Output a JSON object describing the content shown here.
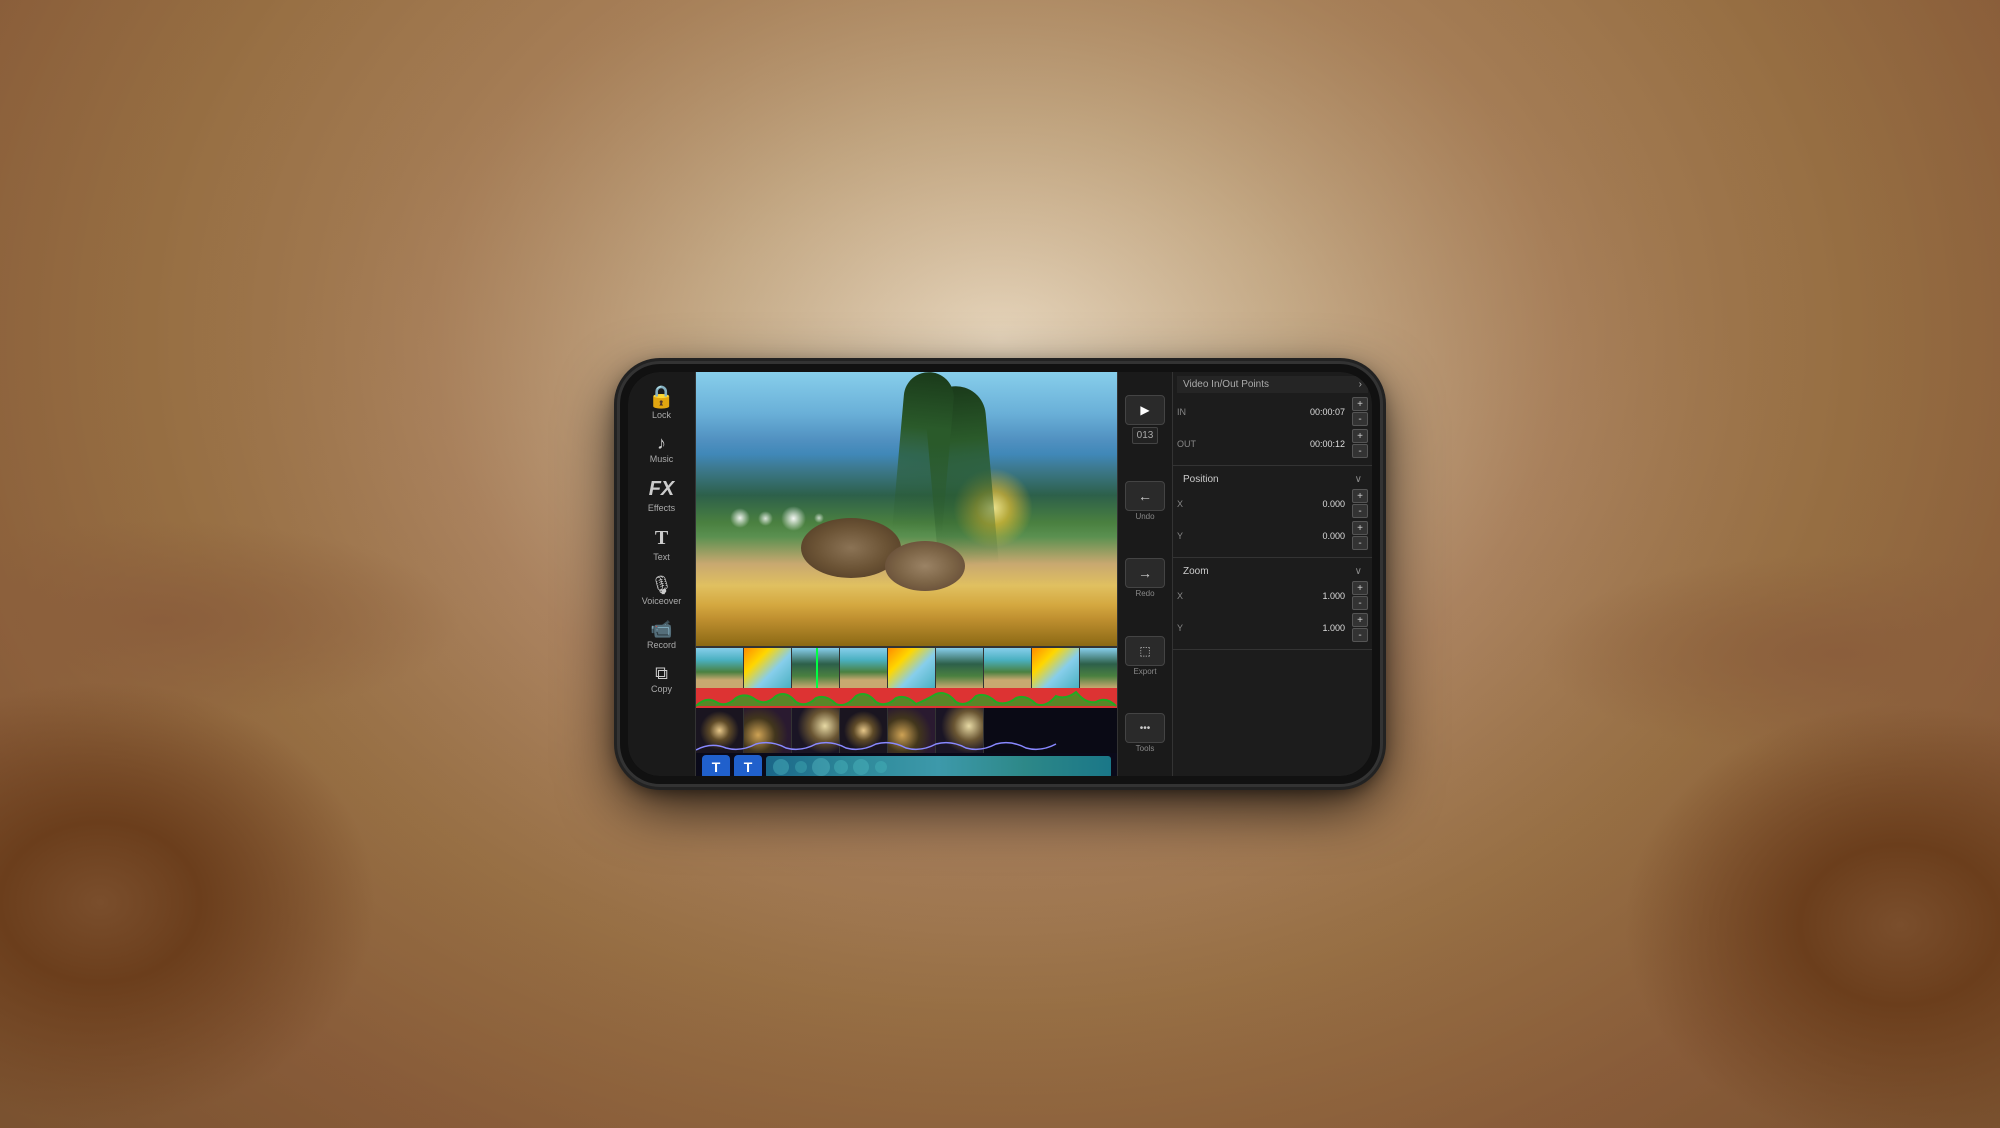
{
  "background": {
    "color": "#b89060"
  },
  "phone": {
    "sidebar": {
      "items": [
        {
          "id": "lock",
          "icon": "🔒",
          "label": "Lock"
        },
        {
          "id": "music",
          "icon": "♪",
          "label": "Music"
        },
        {
          "id": "effects",
          "icon": "FX",
          "label": "Effects"
        },
        {
          "id": "text",
          "icon": "T",
          "label": "Text"
        },
        {
          "id": "voiceover",
          "icon": "🎙",
          "label": "Voiceover"
        },
        {
          "id": "record",
          "icon": "📹",
          "label": "Record"
        },
        {
          "id": "copy",
          "icon": "⧉",
          "label": "Copy"
        }
      ]
    },
    "center_controls": {
      "play_icon": "▶",
      "track_number": "013",
      "undo_icon": "←",
      "undo_label": "Undo",
      "redo_icon": "→",
      "redo_label": "Redo",
      "export_icon": "⬚",
      "export_label": "Export",
      "tools_icon": "•••",
      "tools_label": "Tools"
    },
    "right_panel": {
      "title": "Video In/Out Points",
      "in_label": "IN",
      "in_value": "00:00:07",
      "out_label": "OUT",
      "out_value": "00:00:12",
      "position_label": "Position",
      "position_x_label": "X",
      "position_x_value": "0.000",
      "position_y_label": "Y",
      "position_y_value": "0.000",
      "zoom_label": "Zoom",
      "zoom_x_label": "X",
      "zoom_x_value": "1.000",
      "zoom_y_label": "Y",
      "zoom_y_value": "1.000",
      "plus_label": "+",
      "minus_label": "-"
    },
    "timeline": {
      "track_types": [
        "video",
        "waveform",
        "bokeh",
        "title",
        "audio_blue",
        "audio_teal"
      ],
      "title_badges": [
        "T",
        "T"
      ]
    }
  }
}
